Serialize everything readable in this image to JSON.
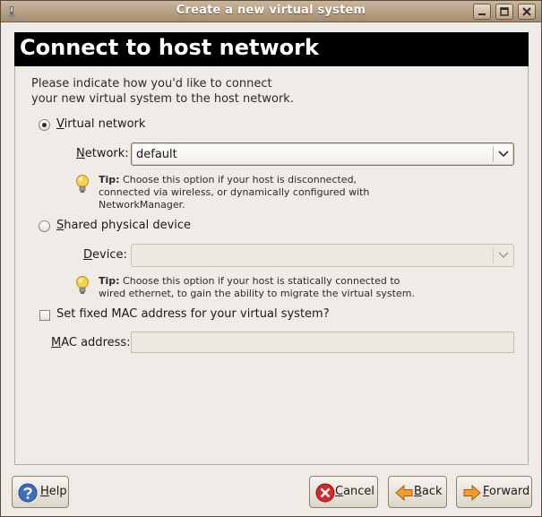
{
  "window": {
    "title": "Create a new virtual system"
  },
  "header": {
    "title": "Connect to host network"
  },
  "intro": "Please indicate how you'd like to connect\nyour new virtual system to the host network.",
  "virtual_network": {
    "radio_label_mnemonic": "V",
    "radio_label_rest": "irtual network",
    "selected": true,
    "network_label_mnemonic": "N",
    "network_label_rest": "etwork:",
    "network_value": "default",
    "tip_bold": "Tip:",
    "tip_text": " Choose this option if your host is disconnected,\nconnected via wireless, or dynamically configured with\nNetworkManager."
  },
  "shared_device": {
    "radio_label_mnemonic": "S",
    "radio_label_rest": "hared physical device",
    "selected": false,
    "device_label_mnemonic": "D",
    "device_label_rest": "evice:",
    "device_value": "",
    "tip_bold": "Tip:",
    "tip_text": " Choose this option if your host is statically connected to\nwired ethernet, to gain the ability to migrate the virtual system."
  },
  "mac": {
    "checkbox_label_before": "Set f",
    "checkbox_label_mnemonic": "i",
    "checkbox_label_after": "xed MAC address for your virtual system?",
    "checked": false,
    "field_label_mnemonic": "M",
    "field_label_rest": "AC address:",
    "field_value": ""
  },
  "buttons": {
    "help_mnemonic": "H",
    "help_rest": "elp",
    "cancel_mnemonic": "C",
    "cancel_rest": "ancel",
    "back_mnemonic": "B",
    "back_rest": "ack",
    "forward_mnemonic": "F",
    "forward_rest": "orward"
  },
  "icons": {
    "title_icon": "app-icon",
    "help": "help-icon",
    "cancel": "cancel-icon",
    "back": "back-arrow-icon",
    "forward": "forward-arrow-icon",
    "tip": "lightbulb-icon"
  },
  "colors": {
    "header_bg": "#000000",
    "titlebar": "#a68c6e",
    "window_bg": "#efebe7"
  }
}
